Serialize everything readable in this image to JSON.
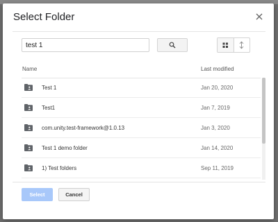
{
  "dialog": {
    "title": "Select Folder",
    "close_icon": "close-icon"
  },
  "search": {
    "value": "test 1",
    "button_icon": "search-icon"
  },
  "view_toggle": {
    "grid_icon": "grid-view-icon",
    "sort_icon": "sort-icon"
  },
  "table": {
    "columns": [
      "Name",
      "Last modified"
    ],
    "rows": [
      {
        "name": "Test 1",
        "modified": "Jan 20, 2020",
        "icon": "shared-folder-icon"
      },
      {
        "name": "Test1",
        "modified": "Jan 7, 2019",
        "icon": "shared-folder-icon"
      },
      {
        "name": "com.unity.test-framework@1.0.13",
        "modified": "Jan 3, 2020",
        "icon": "shared-folder-icon"
      },
      {
        "name": "Test 1 demo folder",
        "modified": "Jan 14, 2020",
        "icon": "shared-folder-icon"
      },
      {
        "name": "1) Test folders",
        "modified": "Sep 11, 2019",
        "icon": "shared-folder-icon"
      }
    ]
  },
  "footer": {
    "select_label": "Select",
    "cancel_label": "Cancel"
  },
  "colors": {
    "primary_disabled": "#a8c8fa",
    "backdrop": "#6f6f6f"
  }
}
